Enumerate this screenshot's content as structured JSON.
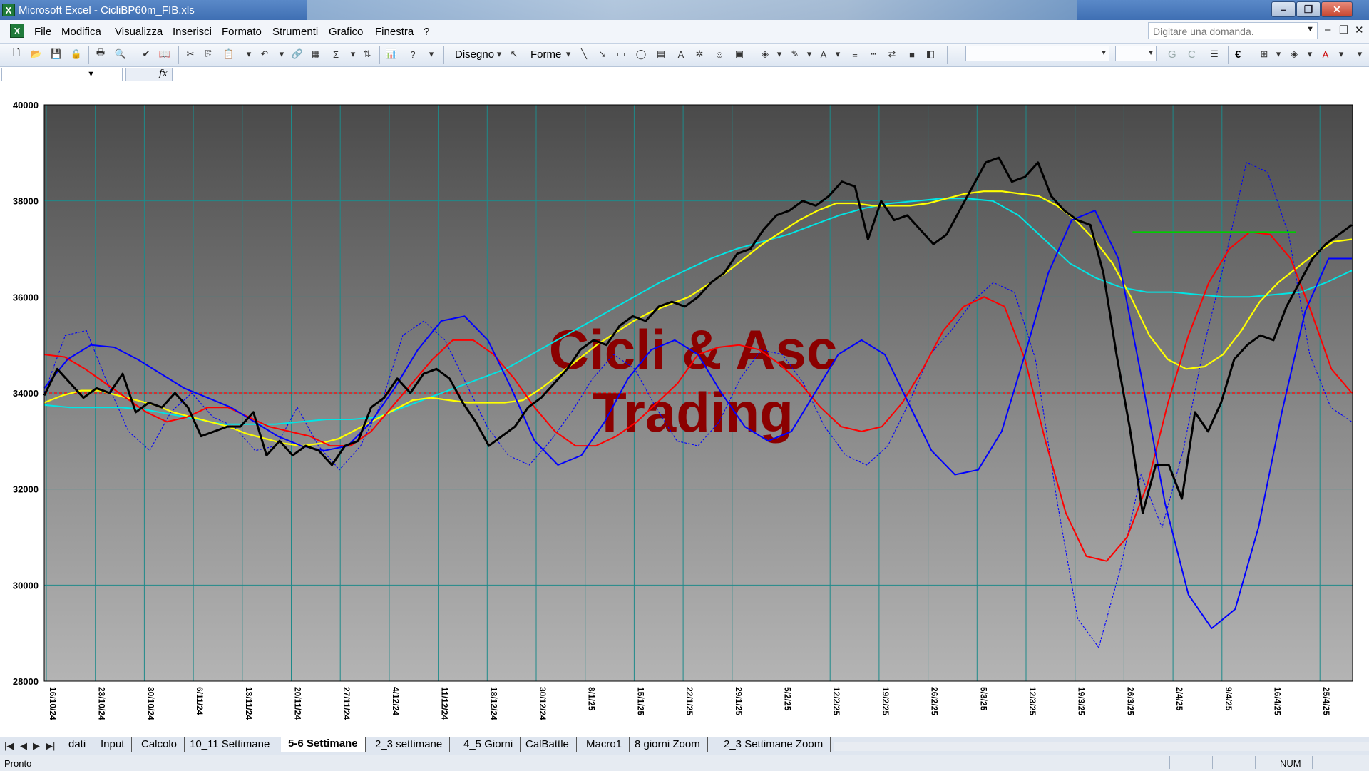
{
  "window": {
    "title": "Microsoft Excel - CicliBP60m_FIB.xls",
    "app_icon": "excel-icon"
  },
  "menu": {
    "items": [
      "File",
      "Modifica",
      "Visualizza",
      "Inserisci",
      "Formato",
      "Strumenti",
      "Grafico",
      "Finestra",
      "?"
    ],
    "ask_placeholder": "Digitare una domanda."
  },
  "toolbar": {
    "drawing_label": "Disegno",
    "shapes_label": "Forme",
    "bold_label": "G",
    "italic_label": "C",
    "euro_label": "€"
  },
  "watermark": {
    "line1": "Cicli & Asc",
    "line2": "Trading",
    "color": "#8b0000"
  },
  "sheets": {
    "tabs": [
      "dati",
      "Input",
      "Calcolo",
      "10_11 Settimane",
      "5-6 Settimane",
      "2_3 settimane",
      "4_5 Giorni",
      "CalBattle",
      "Macro1",
      "8 giorni Zoom",
      "2_3 Settimane Zoom"
    ],
    "active": "5-6 Settimane"
  },
  "status": {
    "text": "Pronto",
    "num": "NUM"
  },
  "colors": {
    "price": "#000000",
    "yellow": "#ffff00",
    "cyan": "#00e5e5",
    "red": "#ff0000",
    "blue": "#0000ff",
    "level": "#00cc00",
    "refline": "#ff0000"
  },
  "chart_data": {
    "type": "line",
    "ylim": [
      28000,
      40000
    ],
    "yticks": [
      28000,
      30000,
      32000,
      34000,
      36000,
      38000,
      40000
    ],
    "ytick_labels": [
      "28000",
      "30000",
      "32000",
      "34000",
      "36000",
      "38000",
      "40000"
    ],
    "xticks": [
      "16/10/24",
      "23/10/24",
      "30/10/24",
      "6/11/24",
      "13/11/24",
      "20/11/24",
      "27/11/24",
      "4/12/24",
      "11/12/24",
      "18/12/24",
      "30/12/24",
      "8/1/25",
      "15/1/25",
      "22/1/25",
      "29/1/25",
      "5/2/25",
      "12/2/25",
      "19/2/25",
      "26/2/25",
      "5/3/25",
      "12/3/25",
      "19/3/25",
      "26/3/25",
      "2/4/25",
      "9/4/25",
      "16/4/25",
      "25/4/25"
    ],
    "grid": "vertical and horizontal",
    "reference_line": 34000,
    "level_line": {
      "y": 37350,
      "from": "26/3/25",
      "to": "23/4/25"
    },
    "series": [
      {
        "values": [
          33950,
          34500,
          34200,
          33900,
          34100,
          34000,
          34400,
          33600,
          33800,
          33700,
          34000,
          33700,
          33100,
          33200,
          33300,
          33300,
          33600,
          32700,
          33000,
          32700,
          32900,
          32800,
          32500,
          32900,
          33000,
          33700,
          33900,
          34300,
          34000,
          34400,
          34500,
          34300,
          33800,
          33400,
          32900,
          33100,
          33300,
          33700,
          33900,
          34200,
          34500,
          34900,
          35100,
          35000,
          35400,
          35600,
          35500,
          35800,
          35900,
          35800,
          36000,
          36300,
          36500,
          36900,
          37000,
          37400,
          37700,
          37800,
          38000,
          37900,
          38100,
          38400,
          38300,
          37200,
          38000,
          37600,
          37700,
          37400,
          37100,
          37300,
          37800,
          38300,
          38800,
          38900,
          38400,
          38500,
          38800,
          38100,
          37800,
          37600,
          37500,
          36500,
          34800,
          33300,
          31500,
          32500,
          32500,
          31800,
          33600,
          33200,
          33800,
          34700,
          35000,
          35200,
          35100,
          35800,
          36300,
          36800,
          37100,
          37300,
          37500
        ]
      },
      {
        "name": "yellow",
        "values": [
          33800,
          33950,
          34050,
          34050,
          33950,
          33850,
          33750,
          33600,
          33500,
          33400,
          33300,
          33150,
          33050,
          32950,
          32900,
          32950,
          33050,
          33250,
          33450,
          33650,
          33850,
          33900,
          33850,
          33800,
          33800,
          33800,
          33850,
          34100,
          34400,
          34700,
          35000,
          35250,
          35500,
          35700,
          35850,
          36000,
          36250,
          36500,
          36800,
          37100,
          37350,
          37600,
          37800,
          37950,
          37950,
          37900,
          37900,
          37900,
          37950,
          38050,
          38150,
          38200,
          38200,
          38150,
          38100,
          37900,
          37600,
          37200,
          36700,
          36000,
          35200,
          34700,
          34500,
          34550,
          34800,
          35300,
          35900,
          36300,
          36600,
          36900,
          37150,
          37200
        ]
      },
      {
        "name": "cyan",
        "values": [
          33750,
          33700,
          33700,
          33700,
          33650,
          33550,
          33450,
          33350,
          33350,
          33350,
          33400,
          33450,
          33450,
          33500,
          33700,
          33900,
          34100,
          34300,
          34500,
          34800,
          35100,
          35400,
          35700,
          36000,
          36300,
          36550,
          36800,
          37000,
          37150,
          37300,
          37500,
          37700,
          37850,
          37950,
          38000,
          38050,
          38050,
          38000,
          37700,
          37200,
          36700,
          36400,
          36200,
          36100,
          36100,
          36050,
          36000,
          36000,
          36050,
          36100,
          36300,
          36550
        ]
      },
      {
        "name": "red",
        "values": [
          34800,
          34750,
          34500,
          34200,
          33900,
          33600,
          33400,
          33500,
          33700,
          33700,
          33500,
          33300,
          33200,
          33100,
          32900,
          32900,
          33200,
          33700,
          34200,
          34700,
          35100,
          35100,
          34800,
          34300,
          33700,
          33200,
          32900,
          32900,
          33100,
          33400,
          33800,
          34200,
          34800,
          34950,
          35000,
          34900,
          34600,
          34200,
          33700,
          33300,
          33200,
          33300,
          33800,
          34500,
          35300,
          35800,
          36000,
          35800,
          34700,
          33000,
          31500,
          30600,
          30500,
          31000,
          32100,
          33800,
          35200,
          36300,
          37000,
          37350,
          37300,
          36800,
          35700,
          34500,
          34000
        ]
      },
      {
        "name": "blue",
        "values": [
          34100,
          34700,
          35000,
          34950,
          34700,
          34400,
          34100,
          33900,
          33700,
          33400,
          33100,
          32900,
          32800,
          32900,
          33400,
          34100,
          34900,
          35500,
          35600,
          35100,
          34100,
          33000,
          32500,
          32700,
          33400,
          34300,
          34900,
          35100,
          34800,
          34000,
          33300,
          33000,
          33200,
          34000,
          34800,
          35100,
          34800,
          33800,
          32800,
          32300,
          32400,
          33200,
          34800,
          36500,
          37600,
          37800,
          36800,
          34300,
          31700,
          29800,
          29100,
          29500,
          31200,
          33600,
          35700,
          36800,
          36800
        ]
      },
      {
        "name": "blue-dotted",
        "values": [
          34000,
          35200,
          35300,
          34200,
          33200,
          32800,
          33600,
          34000,
          33500,
          33300,
          32800,
          32900,
          33700,
          32900,
          32400,
          32900,
          33800,
          35200,
          35500,
          35100,
          34200,
          33300,
          32700,
          32500,
          33000,
          33600,
          34300,
          34800,
          34500,
          33700,
          33000,
          32900,
          33400,
          34300,
          34900,
          34800,
          34200,
          33300,
          32700,
          32500,
          32900,
          33800,
          34800,
          35300,
          35900,
          36300,
          36100,
          34700,
          31800,
          29300,
          28700,
          30300,
          32300,
          31200,
          32800,
          35000,
          36800,
          38800,
          38600,
          37300,
          34800,
          33700,
          33400
        ]
      }
    ]
  }
}
